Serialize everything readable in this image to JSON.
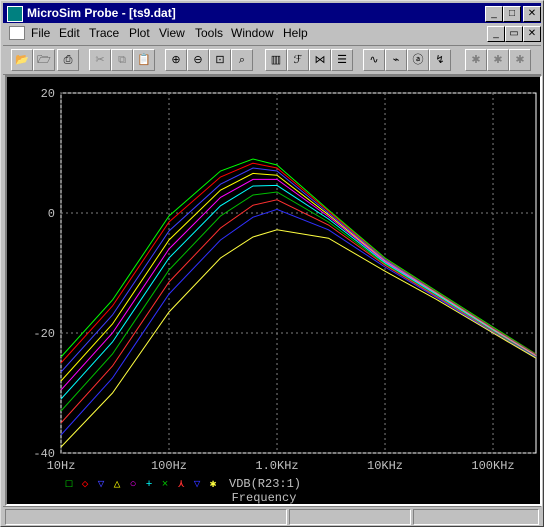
{
  "window": {
    "title": "MicroSim Probe - [ts9.dat]",
    "minimize": "_",
    "maximize": "□",
    "close": "✕"
  },
  "menu": {
    "items": [
      "File",
      "Edit",
      "Trace",
      "Plot",
      "View",
      "Tools",
      "Window",
      "Help"
    ],
    "restore": "▭"
  },
  "toolbar": {
    "buttons": [
      "open",
      "open-folder",
      "print",
      "cut",
      "copy",
      "paste",
      "zoom-in",
      "zoom-out",
      "zoom-area",
      "zoom-fit",
      "log-x",
      "fft",
      "performance",
      "eval",
      "add-trace",
      "cursor",
      "mark-label",
      "text-label",
      "peak",
      "trough",
      "slope"
    ]
  },
  "chart_data": {
    "type": "line",
    "title": "",
    "xlabel": "Frequency",
    "ylabel": "",
    "xscale": "log",
    "xlim": [
      10,
      250000
    ],
    "ylim": [
      -40,
      20
    ],
    "x_ticks": [
      "10Hz",
      "100Hz",
      "1.0KHz",
      "10KHz",
      "100KHz"
    ],
    "y_ticks": [
      "20",
      "0",
      "-20",
      "-40"
    ],
    "grid": true,
    "legend_text": "VDB(R23:1)",
    "legend_markers": [
      "□",
      "◇",
      "▽",
      "△",
      "○",
      "+",
      "×",
      "⋏",
      "▽",
      "✱"
    ],
    "series": [
      {
        "color": "#00ff00",
        "x": [
          10,
          30,
          100,
          300,
          600,
          1000,
          3000,
          10000,
          30000,
          100000,
          250000
        ],
        "values": [
          -24,
          -14.5,
          -0.5,
          7,
          9,
          8,
          0.5,
          -7.5,
          -13,
          -19,
          -23.5
        ]
      },
      {
        "color": "#ff0000",
        "x": [
          10,
          30,
          100,
          300,
          600,
          1000,
          3000,
          10000,
          30000,
          100000,
          250000
        ],
        "values": [
          -25,
          -15.5,
          -1.5,
          6,
          8.3,
          7.5,
          0.3,
          -7.7,
          -13.2,
          -19.2,
          -23.6
        ]
      },
      {
        "color": "#4040ff",
        "x": [
          10,
          30,
          100,
          300,
          600,
          1000,
          3000,
          10000,
          30000,
          100000,
          250000
        ],
        "values": [
          -26.5,
          -17,
          -3,
          4.8,
          7.5,
          7,
          0,
          -7.8,
          -13.3,
          -19.3,
          -23.7
        ]
      },
      {
        "color": "#ffff00",
        "x": [
          10,
          30,
          100,
          300,
          600,
          1000,
          3000,
          10000,
          30000,
          100000,
          250000
        ],
        "values": [
          -28,
          -18.5,
          -4.5,
          3.8,
          6.6,
          6.3,
          -0.3,
          -8,
          -13.4,
          -19.4,
          -23.8
        ]
      },
      {
        "color": "#ff00ff",
        "x": [
          10,
          30,
          100,
          300,
          600,
          1000,
          3000,
          10000,
          30000,
          100000,
          250000
        ],
        "values": [
          -29.5,
          -20,
          -6,
          2.6,
          5.6,
          5.6,
          -0.6,
          -8.1,
          -13.5,
          -19.5,
          -23.9
        ]
      },
      {
        "color": "#00ffff",
        "x": [
          10,
          30,
          100,
          300,
          600,
          1000,
          3000,
          10000,
          30000,
          100000,
          250000
        ],
        "values": [
          -31,
          -21.5,
          -7.5,
          1.2,
          4.5,
          4.6,
          -1,
          -8.3,
          -13.6,
          -19.6,
          -24
        ]
      },
      {
        "color": "#00c000",
        "x": [
          10,
          30,
          100,
          300,
          600,
          1000,
          3000,
          10000,
          30000,
          100000,
          250000
        ],
        "values": [
          -33,
          -23.5,
          -9.5,
          -0.5,
          3,
          3.5,
          -1.5,
          -8.5,
          -13.8,
          -19.7,
          -24
        ]
      },
      {
        "color": "#ff3030",
        "x": [
          10,
          30,
          100,
          300,
          600,
          1000,
          3000,
          10000,
          30000,
          100000,
          250000
        ],
        "values": [
          -35,
          -25.5,
          -11.5,
          -2.5,
          1.3,
          2.2,
          -2,
          -8.7,
          -13.9,
          -19.8,
          -24.1
        ]
      },
      {
        "color": "#3030ff",
        "x": [
          10,
          30,
          100,
          300,
          600,
          1000,
          3000,
          10000,
          30000,
          100000,
          250000
        ],
        "values": [
          -37,
          -27.5,
          -13.5,
          -4.5,
          -0.7,
          0.6,
          -2.8,
          -9,
          -14.1,
          -19.9,
          -24.1
        ]
      },
      {
        "color": "#ffff40",
        "x": [
          10,
          30,
          100,
          300,
          600,
          1000,
          3000,
          10000,
          30000,
          100000,
          250000
        ],
        "values": [
          -39,
          -30,
          -16.5,
          -7.5,
          -4,
          -2.8,
          -4.2,
          -9.7,
          -14.4,
          -20,
          -24.2
        ]
      }
    ]
  }
}
